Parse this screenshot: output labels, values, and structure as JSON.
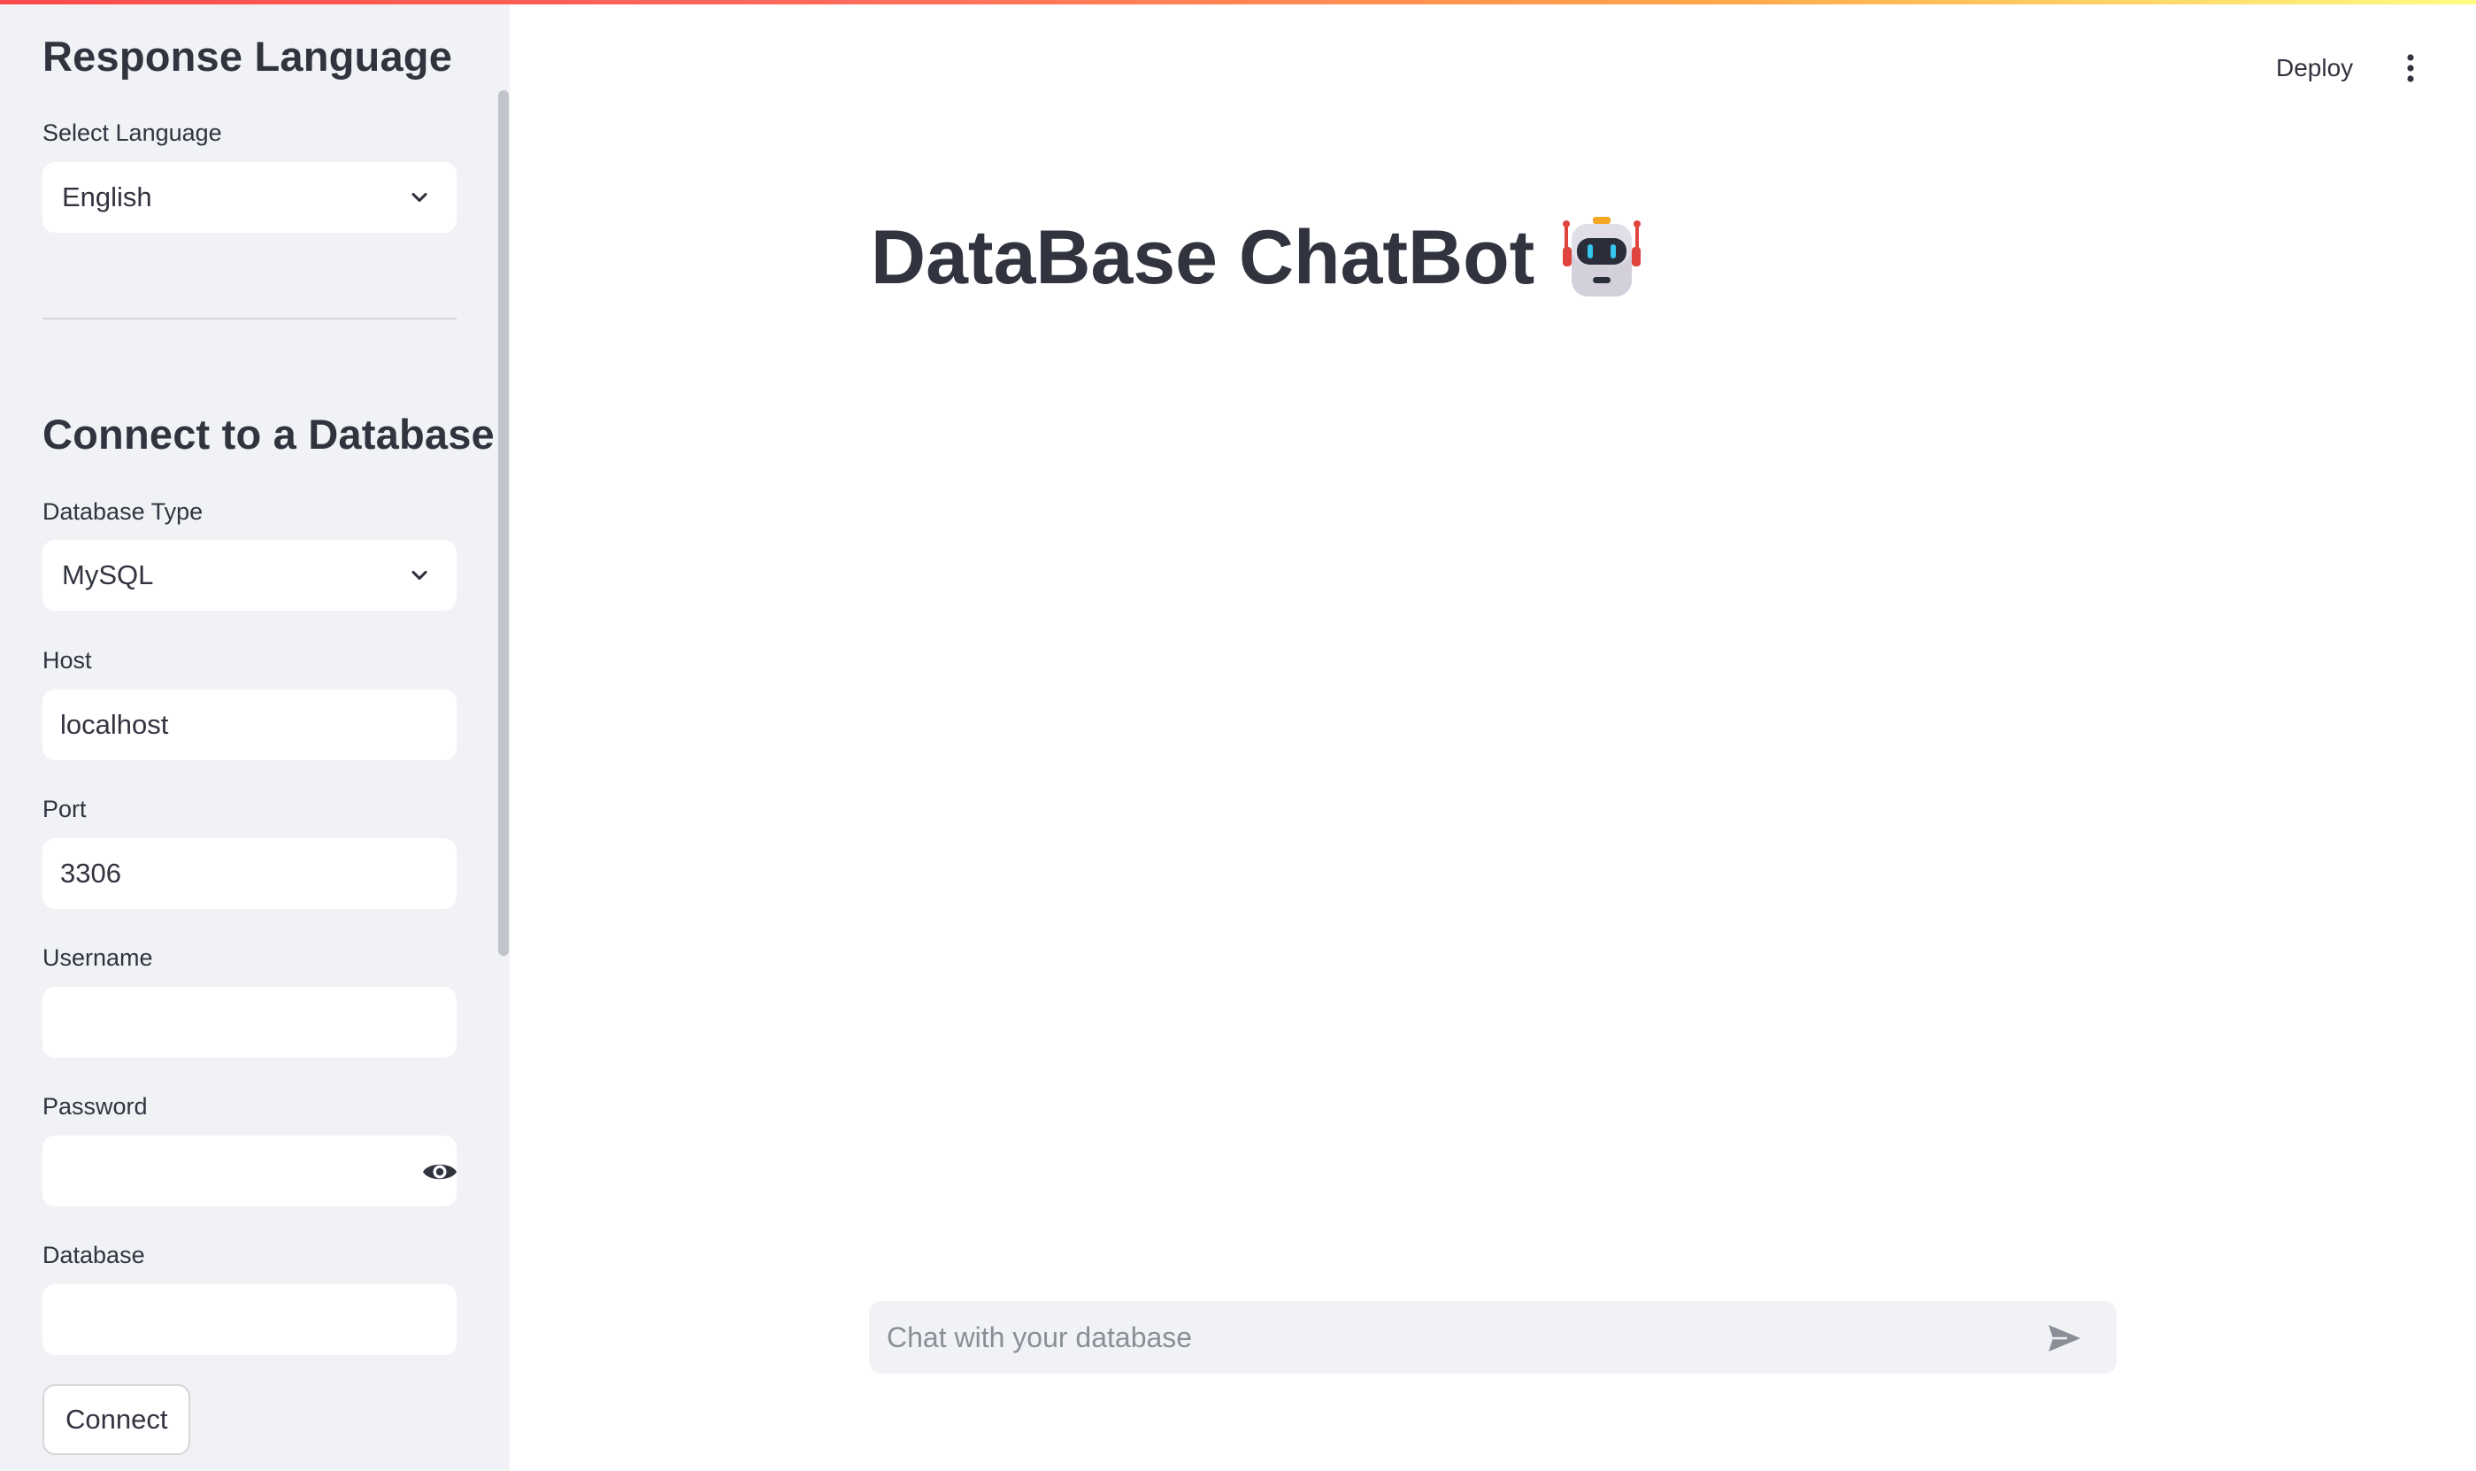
{
  "sidebar": {
    "language_section": {
      "heading": "Response Language",
      "select_label": "Select Language",
      "selected_language": "English"
    },
    "database_section": {
      "heading": "Connect to a Database",
      "type_label": "Database Type",
      "selected_type": "MySQL",
      "host_label": "Host",
      "host_value": "localhost",
      "port_label": "Port",
      "port_value": "3306",
      "username_label": "Username",
      "username_value": "",
      "password_label": "Password",
      "password_value": "",
      "database_label": "Database",
      "database_value": "",
      "connect_label": "Connect"
    }
  },
  "header": {
    "deploy_label": "Deploy",
    "menu_icon": "more-vertical-icon"
  },
  "main": {
    "title": "DataBase ChatBot",
    "title_icon": "robot-icon",
    "chat_placeholder": "Chat with your database",
    "send_icon": "send-icon"
  },
  "colors": {
    "sidebar_bg": "#f0f2f6",
    "text": "#31333f",
    "decoration_start": "#ff4b4b",
    "decoration_end": "#fffd80"
  }
}
